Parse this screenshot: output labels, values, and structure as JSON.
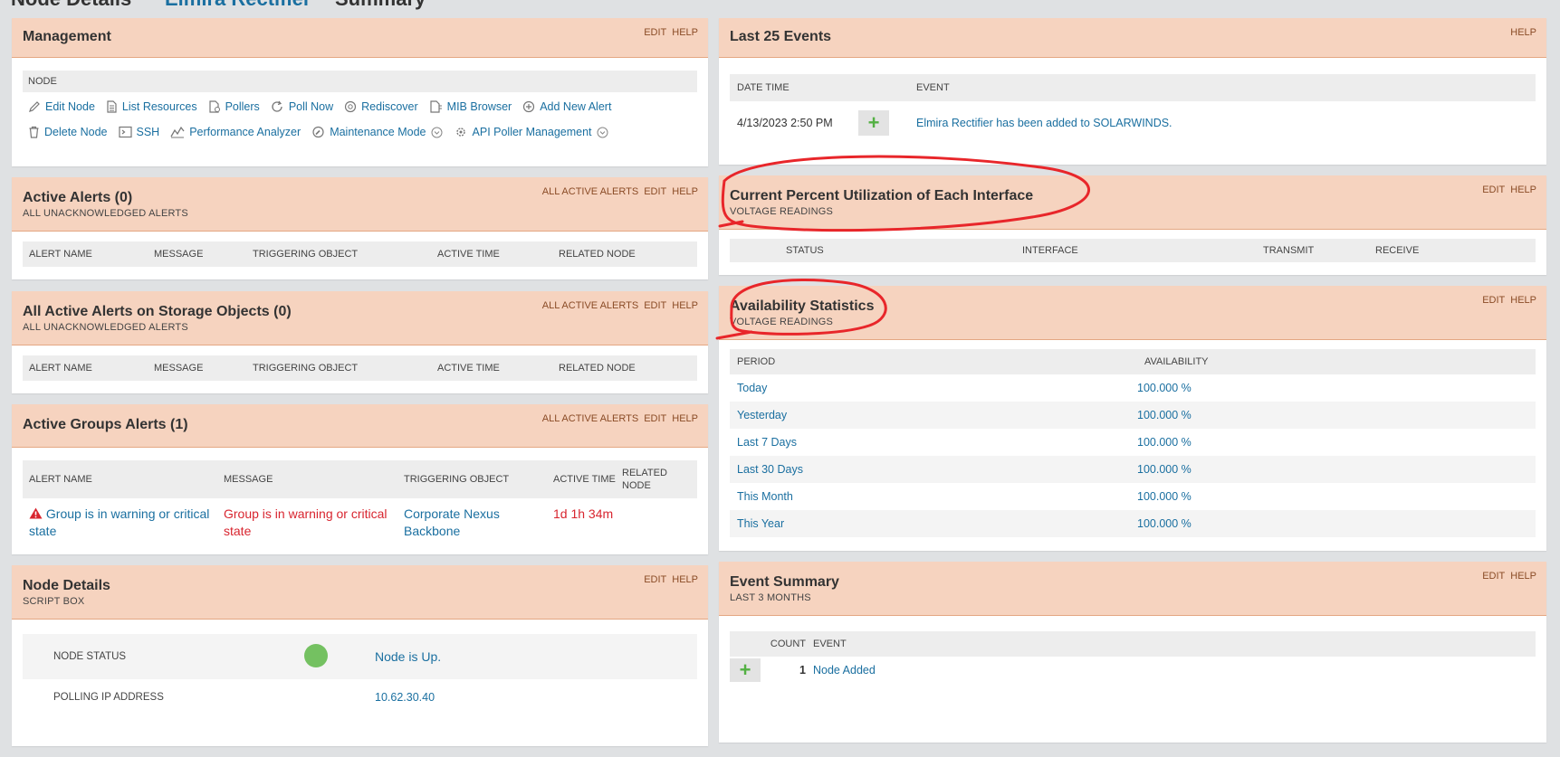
{
  "breadcrumb": {
    "node_details": "Node Details",
    "node_name": "Elmira Rectifier",
    "summary": "Summary"
  },
  "colors": {
    "panel_header": "#f6d3bf",
    "link": "#1a6fa0",
    "alert_red": "#d8252f",
    "status_up": "#74c161",
    "annotation_red": "#e8262a"
  },
  "management": {
    "title": "Management",
    "edit": "EDIT",
    "help": "HELP",
    "section_label": "NODE",
    "row1": [
      {
        "label": "Edit Node",
        "icon": "pencil-icon"
      },
      {
        "label": "List Resources",
        "icon": "document-icon"
      },
      {
        "label": "Pollers",
        "icon": "pollers-icon"
      },
      {
        "label": "Poll Now",
        "icon": "refresh-icon"
      },
      {
        "label": "Rediscover",
        "icon": "rediscover-icon"
      },
      {
        "label": "MIB Browser",
        "icon": "mib-browser-icon"
      },
      {
        "label": "Add New Alert",
        "icon": "plus-circle-icon"
      }
    ],
    "row2": [
      {
        "label": "Delete Node",
        "icon": "trash-icon"
      },
      {
        "label": "SSH",
        "icon": "terminal-icon"
      },
      {
        "label": "Performance Analyzer",
        "icon": "analyzer-icon"
      },
      {
        "label": "Maintenance Mode",
        "icon": "wrench-icon"
      },
      {
        "label": "API Poller Management",
        "icon": "api-gear-icon"
      }
    ]
  },
  "active_alerts": {
    "title": "Active Alerts (0)",
    "subtitle": "ALL UNACKNOWLEDGED ALERTS",
    "all_active": "ALL ACTIVE ALERTS",
    "edit": "EDIT",
    "help": "HELP",
    "columns": [
      "ALERT NAME",
      "MESSAGE",
      "TRIGGERING OBJECT",
      "ACTIVE TIME",
      "RELATED NODE"
    ]
  },
  "storage_alerts": {
    "title": "All Active Alerts on Storage Objects (0)",
    "subtitle": "ALL UNACKNOWLEDGED ALERTS",
    "all_active": "ALL ACTIVE ALERTS",
    "edit": "EDIT",
    "help": "HELP",
    "columns": [
      "ALERT NAME",
      "MESSAGE",
      "TRIGGERING OBJECT",
      "ACTIVE TIME",
      "RELATED NODE"
    ]
  },
  "group_alerts": {
    "title": "Active Groups Alerts (1)",
    "all_active": "ALL ACTIVE ALERTS",
    "edit": "EDIT",
    "help": "HELP",
    "columns": [
      "ALERT NAME",
      "MESSAGE",
      "TRIGGERING OBJECT",
      "ACTIVE TIME",
      "RELATED NODE"
    ],
    "row": {
      "alert_name": "Group is in warning or critical state",
      "message": "Group is in warning or critical state",
      "triggering_object": "Corporate Nexus Backbone",
      "active_time": "1d 1h 34m",
      "related_node": ""
    }
  },
  "node_details": {
    "title": "Node Details",
    "subtitle": "SCRIPT BOX",
    "edit": "EDIT",
    "help": "HELP",
    "status_label": "NODE STATUS",
    "status_value": "Node is Up.",
    "ip_label": "POLLING IP ADDRESS",
    "ip_value": "10.62.30.40"
  },
  "last_events": {
    "title": "Last 25 Events",
    "help": "HELP",
    "col_date": "DATE TIME",
    "col_event": "EVENT",
    "row": {
      "date": "4/13/2023 2:50 PM",
      "event": "Elmira Rectifier has been added to SOLARWINDS."
    }
  },
  "interface_util": {
    "title": "Current Percent Utilization of Each Interface",
    "subtitle": "VOLTAGE READINGS",
    "edit": "EDIT",
    "help": "HELP",
    "columns": [
      "STATUS",
      "INTERFACE",
      "TRANSMIT",
      "RECEIVE"
    ]
  },
  "availability": {
    "title": "Availability Statistics",
    "subtitle": "VOLTAGE READINGS",
    "edit": "EDIT",
    "help": "HELP",
    "col_period": "PERIOD",
    "col_availability": "AVAILABILITY",
    "rows": [
      {
        "period": "Today",
        "value": "100.000 %"
      },
      {
        "period": "Yesterday",
        "value": "100.000 %"
      },
      {
        "period": "Last 7 Days",
        "value": "100.000 %"
      },
      {
        "period": "Last 30 Days",
        "value": "100.000 %"
      },
      {
        "period": "This Month",
        "value": "100.000 %"
      },
      {
        "period": "This Year",
        "value": "100.000 %"
      }
    ]
  },
  "event_summary": {
    "title": "Event Summary",
    "subtitle": "LAST 3 MONTHS",
    "edit": "EDIT",
    "help": "HELP",
    "col_count": "COUNT",
    "col_event": "EVENT",
    "row": {
      "count": "1",
      "event": "Node Added"
    }
  }
}
